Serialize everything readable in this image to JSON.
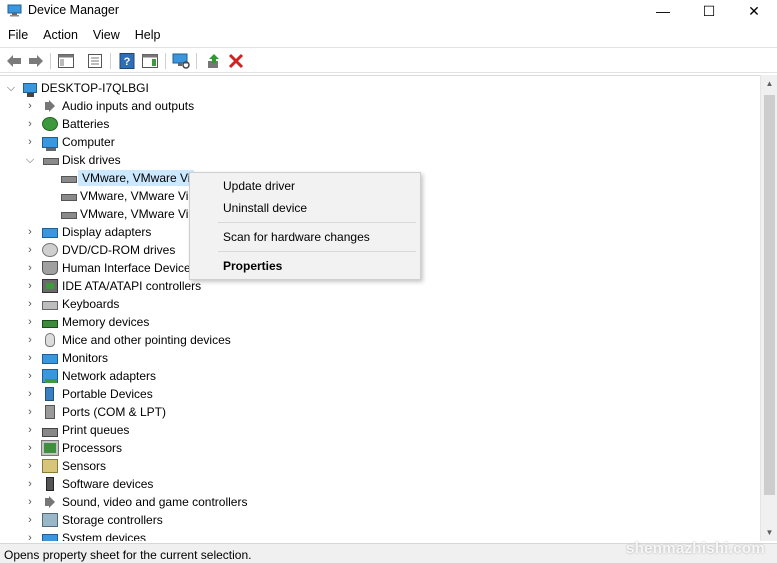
{
  "window": {
    "title": "Device Manager",
    "minimize_glyph": "—",
    "maximize_glyph": "☐",
    "close_glyph": "✕"
  },
  "menu": [
    "File",
    "Action",
    "View",
    "Help"
  ],
  "toolbar": {
    "icons": [
      "back-arrow-icon",
      "forward-arrow-icon",
      "show-hide-console-tree-icon",
      "properties-icon",
      "help-icon",
      "action-pane-icon",
      "scan-hardware-icon",
      "update-driver-icon",
      "uninstall-device-icon"
    ]
  },
  "tree": {
    "root": "DESKTOP-I7QLBGI",
    "categories": [
      {
        "label": "Audio inputs and outputs",
        "icon": "speaker-icon",
        "expanded": false
      },
      {
        "label": "Batteries",
        "icon": "battery-icon",
        "expanded": false
      },
      {
        "label": "Computer",
        "icon": "computer-icon",
        "expanded": false
      },
      {
        "label": "Disk drives",
        "icon": "disk-drive-icon",
        "expanded": true
      },
      {
        "label": "Display adapters",
        "icon": "display-adapter-icon",
        "expanded": false
      },
      {
        "label": "DVD/CD-ROM drives",
        "icon": "dvd-icon",
        "expanded": false
      },
      {
        "label": "Human Interface Devices",
        "icon": "hid-icon",
        "expanded": false
      },
      {
        "label": "IDE ATA/ATAPI controllers",
        "icon": "ide-controller-icon",
        "expanded": false
      },
      {
        "label": "Keyboards",
        "icon": "keyboard-icon",
        "expanded": false
      },
      {
        "label": "Memory devices",
        "icon": "memory-icon",
        "expanded": false
      },
      {
        "label": "Mice and other pointing devices",
        "icon": "mouse-icon",
        "expanded": false
      },
      {
        "label": "Monitors",
        "icon": "monitor-icon",
        "expanded": false
      },
      {
        "label": "Network adapters",
        "icon": "network-adapter-icon",
        "expanded": false
      },
      {
        "label": "Portable Devices",
        "icon": "portable-device-icon",
        "expanded": false
      },
      {
        "label": "Ports (COM & LPT)",
        "icon": "port-icon",
        "expanded": false
      },
      {
        "label": "Print queues",
        "icon": "printer-icon",
        "expanded": false
      },
      {
        "label": "Processors",
        "icon": "processor-icon",
        "expanded": false
      },
      {
        "label": "Sensors",
        "icon": "sensor-icon",
        "expanded": false
      },
      {
        "label": "Software devices",
        "icon": "software-device-icon",
        "expanded": false
      },
      {
        "label": "Sound, video and game controllers",
        "icon": "sound-controller-icon",
        "expanded": false
      },
      {
        "label": "Storage controllers",
        "icon": "storage-controller-icon",
        "expanded": false
      },
      {
        "label": "System devices",
        "icon": "system-device-icon",
        "expanded": false
      }
    ],
    "disk_children": [
      "VMware, VMware Vi",
      "VMware, VMware Vi",
      "VMware, VMware Vi"
    ]
  },
  "context_menu": {
    "update_driver": "Update driver",
    "uninstall_device": "Uninstall device",
    "scan_hardware": "Scan for hardware changes",
    "properties": "Properties"
  },
  "status": "Opens property sheet for the current selection.",
  "watermark": "shenmazhishi.com",
  "colors": {
    "selection": "#cce8ff",
    "uninstall_red": "#d32020",
    "accent_blue": "#3a96dd"
  }
}
